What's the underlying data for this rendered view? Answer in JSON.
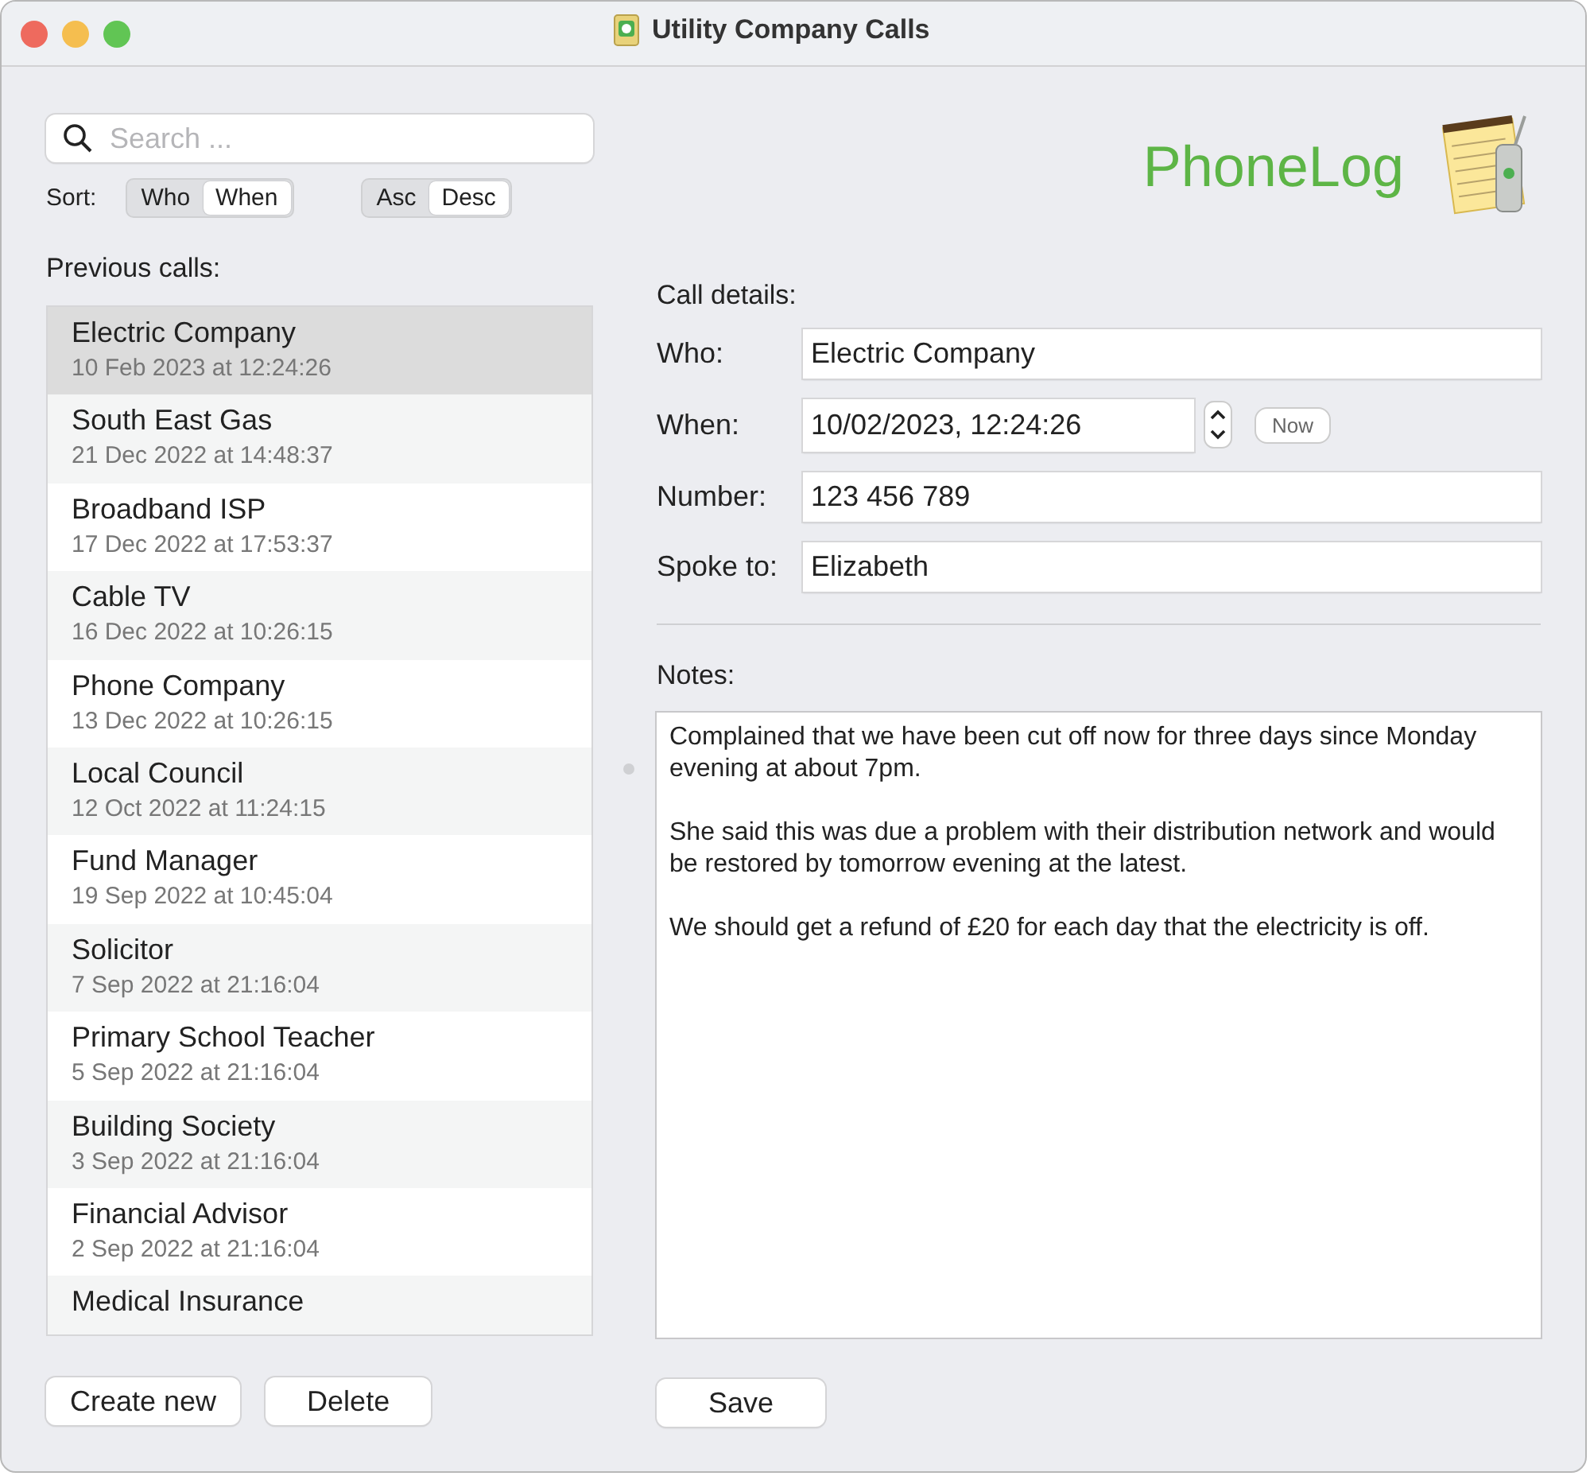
{
  "window": {
    "title": "Utility Company Calls"
  },
  "search": {
    "placeholder": "Search ..."
  },
  "sort": {
    "label": "Sort:",
    "field_options": [
      {
        "label": "Who",
        "selected": false
      },
      {
        "label": "When",
        "selected": true
      }
    ],
    "order_options": [
      {
        "label": "Asc",
        "selected": false
      },
      {
        "label": "Desc",
        "selected": true
      }
    ]
  },
  "logo": {
    "text": "PhoneLog"
  },
  "calls": {
    "title": "Previous calls:",
    "items": [
      {
        "name": "Electric Company",
        "date": "10 Feb 2023 at 12:24:26",
        "selected": true
      },
      {
        "name": "South East Gas",
        "date": "21 Dec 2022 at 14:48:37",
        "selected": false
      },
      {
        "name": "Broadband ISP",
        "date": "17 Dec 2022 at 17:53:37",
        "selected": false
      },
      {
        "name": "Cable TV",
        "date": "16 Dec 2022 at 10:26:15",
        "selected": false
      },
      {
        "name": "Phone Company",
        "date": "13 Dec 2022 at 10:26:15",
        "selected": false
      },
      {
        "name": "Local Council",
        "date": "12 Oct 2022 at 11:24:15",
        "selected": false
      },
      {
        "name": "Fund Manager",
        "date": "19 Sep 2022 at 10:45:04",
        "selected": false
      },
      {
        "name": "Solicitor",
        "date": "7 Sep 2022 at 21:16:04",
        "selected": false
      },
      {
        "name": "Primary School Teacher",
        "date": "5 Sep 2022 at 21:16:04",
        "selected": false
      },
      {
        "name": "Building Society",
        "date": "3 Sep 2022 at 21:16:04",
        "selected": false
      },
      {
        "name": "Financial Advisor",
        "date": "2 Sep 2022 at 21:16:04",
        "selected": false
      },
      {
        "name": "Medical Insurance",
        "selected": false
      }
    ],
    "buttons": [
      "Create new",
      "Delete"
    ]
  },
  "details": {
    "title": "Call details:",
    "fields": [
      {
        "label": "Who:",
        "value": "Electric Company",
        "kind": "text"
      },
      {
        "label": "When:",
        "value": "10/02/2023, 12:24:26",
        "kind": "date",
        "button": "Now"
      },
      {
        "label": "Number:",
        "value": "123 456 789",
        "kind": "text"
      },
      {
        "label": "Spoke to:",
        "value": "Elizabeth",
        "kind": "text"
      }
    ],
    "notes_label": "Notes:",
    "notes": "Complained that we have been cut off now for three days since Monday evening at about 7pm.\n\nShe said this was due a problem with their distribution network and would be restored by tomorrow evening at the latest.\n\nWe should get a refund of £20 for each day that the electricity is off.",
    "save": "Save"
  }
}
